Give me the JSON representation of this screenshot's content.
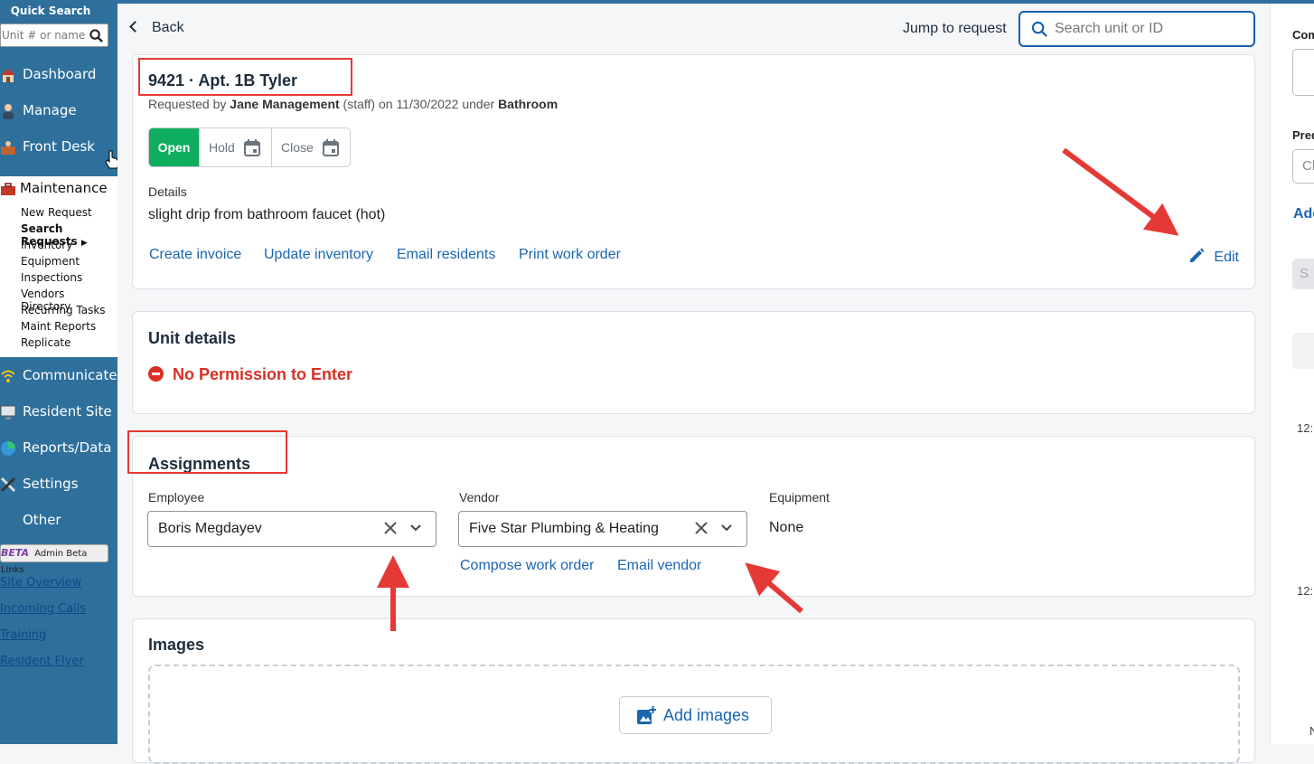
{
  "sidebar": {
    "quick_search_title": "Quick Search",
    "quick_search_placeholder": "Unit # or name",
    "nav_top": [
      {
        "label": "Dashboard",
        "icon": "house-icon"
      },
      {
        "label": "Manage",
        "icon": "person-icon"
      },
      {
        "label": "Front Desk",
        "icon": "desk-icon"
      }
    ],
    "maintenance": {
      "label": "Maintenance",
      "items": [
        "New Request",
        "Search Requests",
        "Inventory",
        "Equipment",
        "Inspections",
        "Vendors Directory",
        "Recurring Tasks",
        "Maint Reports",
        "Replicate"
      ],
      "active_index": 1
    },
    "nav_bottom": [
      {
        "label": "Communicate",
        "icon": "wifi-icon"
      },
      {
        "label": "Resident Site",
        "icon": "monitor-icon"
      },
      {
        "label": "Reports/Data",
        "icon": "pie-chart-icon"
      },
      {
        "label": "Settings",
        "icon": "tools-icon"
      },
      {
        "label": "Other",
        "icon": ""
      }
    ],
    "beta_badge": "BETA",
    "beta_label": "Admin Beta Links",
    "links": [
      "Site Overview",
      "Incoming Calls",
      "Training",
      "Resident Flyer"
    ]
  },
  "header": {
    "back_label": "Back",
    "jump_label": "Jump to request",
    "search_placeholder": "Search unit or ID"
  },
  "request": {
    "title": "9421 · Apt. 1B Tyler",
    "meta_prefix": "Requested by ",
    "requester": "Jane Management",
    "meta_middle": " (staff) on 11/30/2022 under ",
    "category": "Bathroom",
    "status": {
      "open": "Open",
      "hold": "Hold",
      "close": "Close"
    },
    "details_label": "Details",
    "details_text": "slight drip from bathroom faucet (hot)",
    "actions": [
      "Create invoice",
      "Update inventory",
      "Email residents",
      "Print work order"
    ],
    "edit_label": "Edit"
  },
  "unit_details": {
    "title": "Unit details",
    "permission_text": "No Permission to Enter"
  },
  "assignments": {
    "title": "Assignments",
    "employee_label": "Employee",
    "employee_value": "Boris Megdayev",
    "vendor_label": "Vendor",
    "vendor_value": "Five Star Plumbing & Heating",
    "equipment_label": "Equipment",
    "equipment_value": "None",
    "vendor_actions": [
      "Compose work order",
      "Email vendor"
    ]
  },
  "images": {
    "title": "Images",
    "add_label": "Add images"
  },
  "right_panel": {
    "label1": "Com",
    "label2": "Pred",
    "select_text": "Ch",
    "link": "Add",
    "button": "S",
    "time1": "12:",
    "time2": "12:",
    "time3": "N"
  },
  "colors": {
    "sidebar": "#2e6f9c",
    "open_status": "#0fae5e",
    "link": "#1a65b0",
    "alert": "#d93025",
    "annotation": "#e53935"
  }
}
